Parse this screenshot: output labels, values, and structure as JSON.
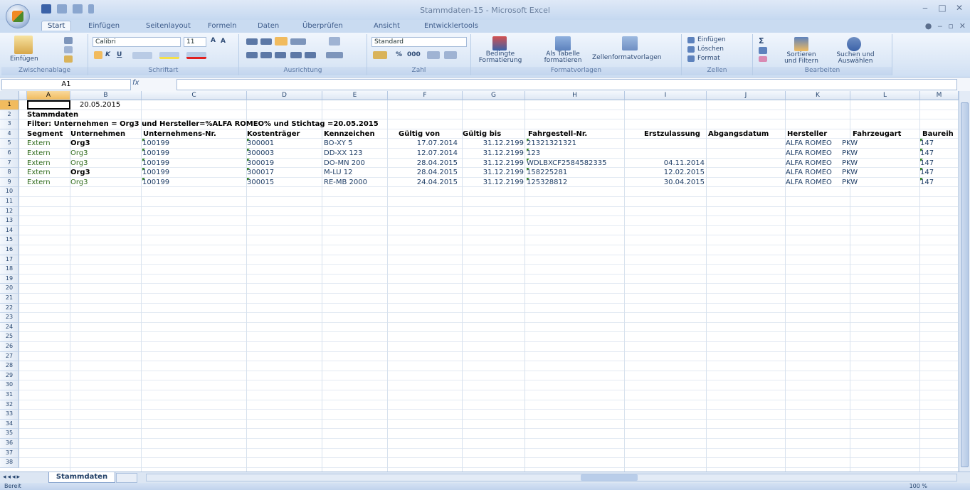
{
  "window": {
    "title": "Stammdaten-15 - Microsoft Excel"
  },
  "ribbon": {
    "tabs": [
      "Start",
      "Einfügen",
      "Seitenlayout",
      "Formeln",
      "Daten",
      "Überprüfen",
      "Ansicht",
      "Entwicklertools"
    ],
    "active_tab": "Start",
    "clipboard": {
      "paste_label": "Einfügen",
      "group_label": "Zwischenablage"
    },
    "font": {
      "name": "Calibri",
      "size": "11",
      "group_label": "Schriftart"
    },
    "alignment": {
      "group_label": "Ausrichtung"
    },
    "number": {
      "format": "Standard",
      "percent": "%",
      "thousands": "000",
      "group_label": "Zahl"
    },
    "styles": {
      "conditional_label": "Bedingte Formatierung",
      "table_label": "Als Tabelle formatieren",
      "cell_styles_label": "Zellenformatvorlagen",
      "group_label": "Formatvorlagen"
    },
    "cells": {
      "insert_label": "Einfügen",
      "delete_label": "Löschen",
      "format_label": "Format",
      "group_label": "Zellen"
    },
    "editing": {
      "sort_label": "Sortieren und Filtern",
      "find_label": "Suchen und Auswählen",
      "group_label": "Bearbeiten"
    }
  },
  "formula_bar": {
    "name_box": "A1",
    "fx": "fx",
    "value": ""
  },
  "sheet": {
    "columns": [
      "A",
      "B",
      "C",
      "D",
      "E",
      "F",
      "G",
      "H",
      "I",
      "J",
      "K",
      "L",
      "M"
    ],
    "selected_column": "A",
    "selected_row": "1",
    "rows": [
      "1",
      "2",
      "3",
      "4",
      "5",
      "6",
      "7",
      "8",
      "9",
      "10",
      "11",
      "12",
      "13",
      "14",
      "15",
      "16",
      "17",
      "18",
      "19",
      "20",
      "21",
      "22",
      "23",
      "24",
      "25",
      "26",
      "27",
      "28",
      "29",
      "30",
      "31",
      "32",
      "33",
      "34",
      "35",
      "36",
      "37",
      "38"
    ],
    "b1_date": "20.05.2015",
    "title": "Stammdaten",
    "filter_text": "Filter: Unternehmen = Org3 und Hersteller=%ALFA ROMEO% und Stichtag =20.05.2015",
    "headers": [
      "Segment",
      "Unternehmen",
      "Unternehmens-Nr.",
      "Kostenträger",
      "Kennzeichen",
      "Gültig von",
      "Gültig bis",
      "Fahrgestell-Nr.",
      "Erstzulassung",
      "Abgangsdatum",
      "Hersteller",
      "Fahrzeugart",
      "Baureih"
    ],
    "records": [
      {
        "segment": "Extern",
        "company": "Org3",
        "company_nr": "100199",
        "cost": "300001",
        "plate": "BO-XY 5",
        "from": "17.07.2014",
        "to": "31.12.2199",
        "vin": "21321321321",
        "first_reg": "",
        "disposal": "",
        "maker": "ALFA ROMEO",
        "type": "PKW",
        "series": "147"
      },
      {
        "segment": "Extern",
        "company": "Org3",
        "company_nr": "100199",
        "cost": "300003",
        "plate": "DD-XX 123",
        "from": "12.07.2014",
        "to": "31.12.2199",
        "vin": "123",
        "first_reg": "",
        "disposal": "",
        "maker": "ALFA ROMEO",
        "type": "PKW",
        "series": "147"
      },
      {
        "segment": "Extern",
        "company": "Org3",
        "company_nr": "100199",
        "cost": "300019",
        "plate": "DO-MN 200",
        "from": "28.04.2015",
        "to": "31.12.2199",
        "vin": "WDLBXCF2584582335",
        "first_reg": "04.11.2014",
        "disposal": "",
        "maker": "ALFA ROMEO",
        "type": "PKW",
        "series": "147"
      },
      {
        "segment": "Extern",
        "company": "Org3",
        "company_nr": "100199",
        "cost": "300017",
        "plate": "M-LU 12",
        "from": "28.04.2015",
        "to": "31.12.2199",
        "vin": "158225281",
        "first_reg": "12.02.2015",
        "disposal": "",
        "maker": "ALFA ROMEO",
        "type": "PKW",
        "series": "147"
      },
      {
        "segment": "Extern",
        "company": "Org3",
        "company_nr": "100199",
        "cost": "300015",
        "plate": "RE-MB 2000",
        "from": "24.04.2015",
        "to": "31.12.2199",
        "vin": "125328812",
        "first_reg": "30.04.2015",
        "disposal": "",
        "maker": "ALFA ROMEO",
        "type": "PKW",
        "series": "147"
      }
    ]
  },
  "sheet_tabs": {
    "active": "Stammdaten"
  },
  "status_bar": {
    "ready": "Bereit",
    "zoom": "100 %"
  }
}
